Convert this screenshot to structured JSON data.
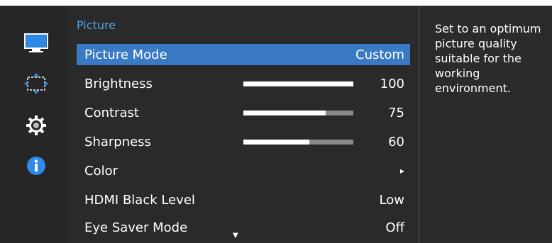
{
  "menu": {
    "title": "Picture",
    "items": [
      {
        "label": "Picture Mode",
        "value": "Custom"
      },
      {
        "label": "Brightness",
        "value": "100",
        "level": 100
      },
      {
        "label": "Contrast",
        "value": "75",
        "level": 75
      },
      {
        "label": "Sharpness",
        "value": "60",
        "level": 60
      },
      {
        "label": "Color",
        "value": "▸"
      },
      {
        "label": "HDMI Black Level",
        "value": "Low"
      },
      {
        "label": "Eye Saver Mode",
        "value": "Off"
      }
    ],
    "more_indicator": "▼"
  },
  "help": {
    "text": "Set to an optimum picture quality suitable for the working environment."
  },
  "icons": [
    "monitor-icon",
    "move-arrows-icon",
    "gear-icon",
    "info-icon"
  ],
  "colors": {
    "accent": "#3a79c4",
    "title": "#4fa6f0",
    "panel": "#2a2a2a"
  }
}
